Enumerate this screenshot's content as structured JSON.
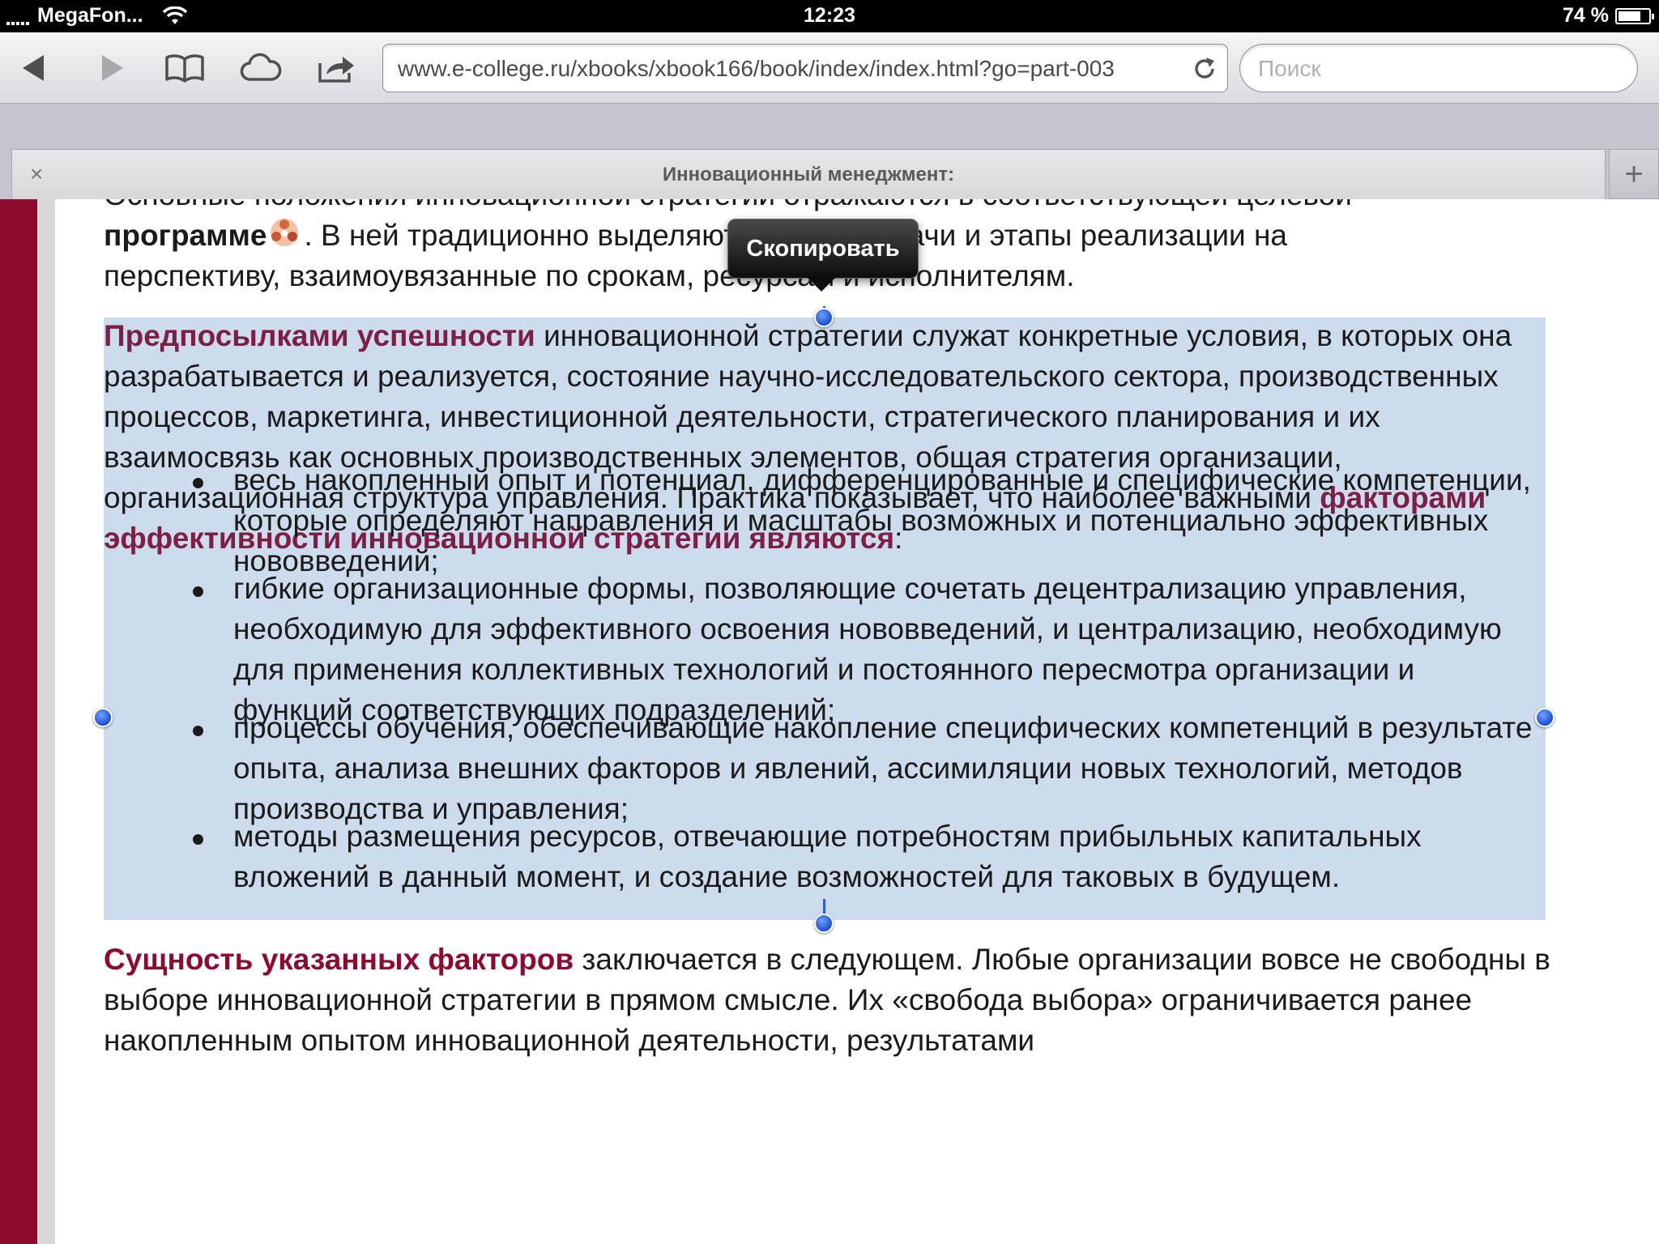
{
  "status_bar": {
    "carrier": "MegaFon...",
    "time": "12:23",
    "battery_text": "74 %",
    "battery_level": 0.74
  },
  "browser": {
    "url": "www.e-college.ru/xbooks/xbook166/book/index/index.html?go=part-003",
    "search_placeholder": "Поиск",
    "tab_title": "Инновационный менеджмент:",
    "new_tab_label": "+",
    "close_tab_label": "×"
  },
  "page": {
    "cut_line": "Основные положения инновационной стратегии отражаются в соответствующей целевой",
    "para1": {
      "bold_word": "программе",
      "rest_line1": ". В ней традиционно выделяются цели, задачи и этапы реализации на",
      "rest_line2": "перспективу, взаимоувязанные по срокам, ресурсам и исполнителям."
    },
    "para2": {
      "lead": "Предпосылками успешности",
      "body": " инновационной стратегии служат конкретные условия, в которых она разрабатывается и реализуется, состояние научно-исследовательского сектора, производственных процессов, маркетинга, инвестиционной деятельности, стратегического планирования и их взаимосвязь как основных производственных элементов, общая стратегия организации, организационная структура управления. Практика показывает, что наиболее важными ",
      "emph": "факторами эффективности инновационной стратегии являются",
      "tail": ":"
    },
    "bullets": [
      "весь накопленный опыт и потенциал, дифференцированные и специфические компетенции, которые определяют направления и масштабы возможных и потенциально эффективных нововведений;",
      "гибкие организационные формы, позволяющие сочетать децентрализацию управления, необходимую для эффективного освоения нововведений, и централизацию, необходимую для применения коллективных технологий и постоянного пересмотра организации и функций соответствующих подразделений;",
      "процессы обучения, обеспечивающие накопление специфических компетенций в результате опыта, анализа внешних факторов и явлений, ассимиляции новых технологий, методов производства и управления;",
      "методы размещения ресурсов, отвечающие потребностям прибыльных капитальных вложений в данный момент, и создание возможностей для таковых в будущем."
    ],
    "para3": {
      "lead": "Сущность указанных факторов",
      "body": " заключается в следующем. Любые организации вовсе не свободны в выборе инновационной стратегии в прямом смысле. Их «свобода выбора» ограничивается ранее накопленным опытом инновационной деятельности, результатами"
    }
  },
  "popup": {
    "copy_label": "Скопировать"
  },
  "colors": {
    "accent_maroon": "#7d1f44",
    "sidebar_red": "#8c0b2e",
    "selection": "#cddcec",
    "handle_blue": "#1a4fd1"
  },
  "icons": [
    "signal-icon",
    "wifi-icon",
    "battery-icon",
    "back-icon",
    "forward-icon",
    "bookmarks-icon",
    "icloud-icon",
    "share-icon",
    "reload-icon",
    "program-link-icon"
  ]
}
